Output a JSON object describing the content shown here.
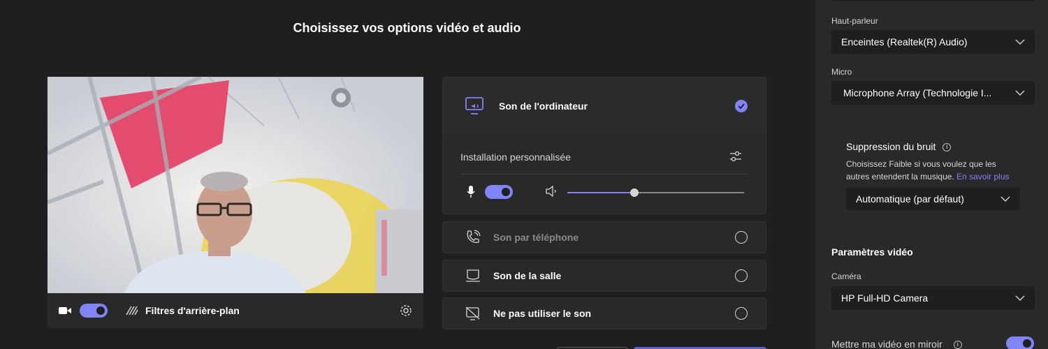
{
  "page": {
    "title": "Choisissez vos options vidéo et audio"
  },
  "video_bar": {
    "background_filters_label": "Filtres d'arrière-plan",
    "camera_on": true
  },
  "audio": {
    "computer_label": "Son de l'ordinateur",
    "custom_setup_label": "Installation personnalisée",
    "mic_on": true,
    "volume_level_percent": 38,
    "phone_label": "Son par téléphone",
    "room_label": "Son de la salle",
    "no_audio_label": "Ne pas utiliser le son"
  },
  "panel": {
    "speaker_label": "Haut-parleur",
    "speaker_value": "Enceintes (Realtek(R) Audio)",
    "mic_label": "Micro",
    "mic_value": "Microphone Array (Technologie I...",
    "noise_title": "Suppression du bruit",
    "noise_help": "Choisissez Faible si vous voulez que les autres entendent la musique.",
    "noise_link": "En savoir plus",
    "noise_value": "Automatique (par défaut)",
    "video_settings_title": "Paramètres vidéo",
    "camera_label": "Caméra",
    "camera_value": "HP Full-HD Camera",
    "mirror_label": "Mettre ma vidéo en miroir",
    "mirror_on": true
  },
  "colors": {
    "accent": "#7f85f5",
    "panel": "#292929",
    "background": "#1f1f1f"
  },
  "icons": [
    "camera-icon",
    "blur-filter-icon",
    "gear-icon",
    "computer-audio-icon",
    "check-icon",
    "sliders-icon",
    "mic-icon",
    "speaker-icon",
    "phone-icon",
    "room-icon",
    "no-audio-icon",
    "chevron-down-icon",
    "info-icon"
  ]
}
